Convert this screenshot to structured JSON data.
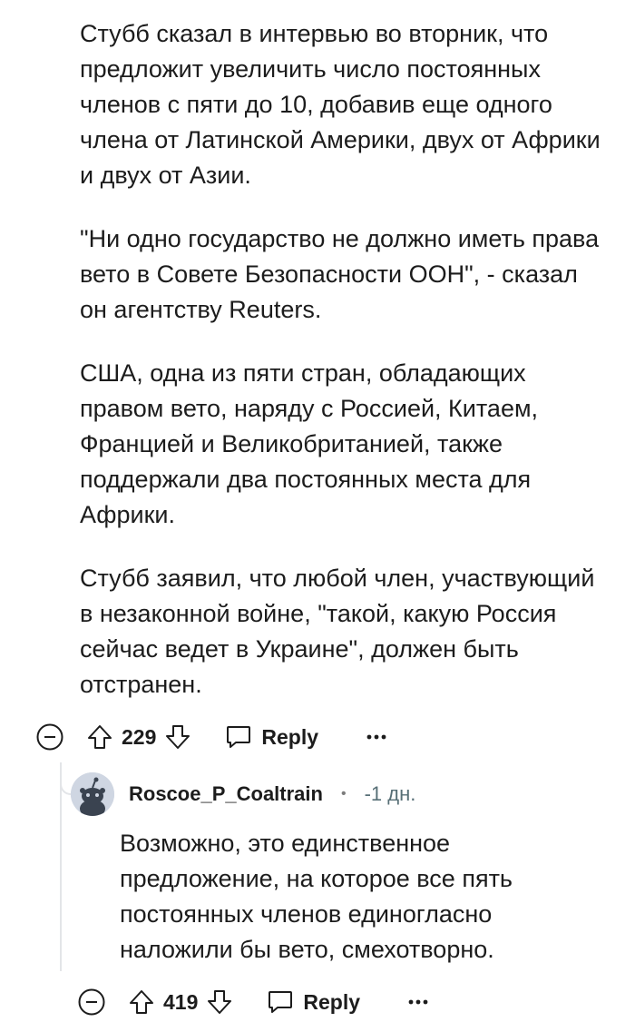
{
  "post_comment": {
    "paragraphs": [
      "Стубб сказал в интервью во вторник, что предложит увеличить число постоянных членов с пяти до 10, добавив еще одного члена от Латинской Америки, двух от Африки и двух от Азии.",
      "\"Ни одно государство не должно иметь права вето в Совете Безопасности ООН\", - сказал он агентству Reuters.",
      "США, одна из пяти стран, обладающих правом вето, наряду с Россией, Китаем, Францией и Великобританией, также поддержали два постоянных места для Африки.",
      "Стубб заявил, что любой член, участвующий в незаконной войне, \"такой, какую Россия сейчас ведет в Украине\", должен быть отстранен."
    ],
    "actions": {
      "score": "229",
      "reply_label": "Reply",
      "collapse_icon": "collapse-minus-icon",
      "upvote_icon": "upvote-arrow-icon",
      "downvote_icon": "downvote-arrow-icon",
      "reply_icon": "speech-bubble-icon",
      "more_icon": "more-dots-icon"
    }
  },
  "reply_comment": {
    "username": "Roscoe_P_Coaltrain",
    "separator": "•",
    "time": "-1 дн.",
    "avatar_icon": "snoo-avatar-icon",
    "text": "Возможно, это единственное предложение, на которое все пять постоянных членов единогласно наложили бы вето, смехотворно.",
    "actions": {
      "score": "419",
      "reply_label": "Reply",
      "collapse_icon": "collapse-minus-icon",
      "upvote_icon": "upvote-arrow-icon",
      "downvote_icon": "downvote-arrow-icon",
      "reply_icon": "speech-bubble-icon",
      "more_icon": "more-dots-icon"
    }
  },
  "colors": {
    "text": "#1c1c1c",
    "meta": "#576f76",
    "thread_line": "#e3e5e8",
    "avatar_bg": "#cfd6e2"
  }
}
